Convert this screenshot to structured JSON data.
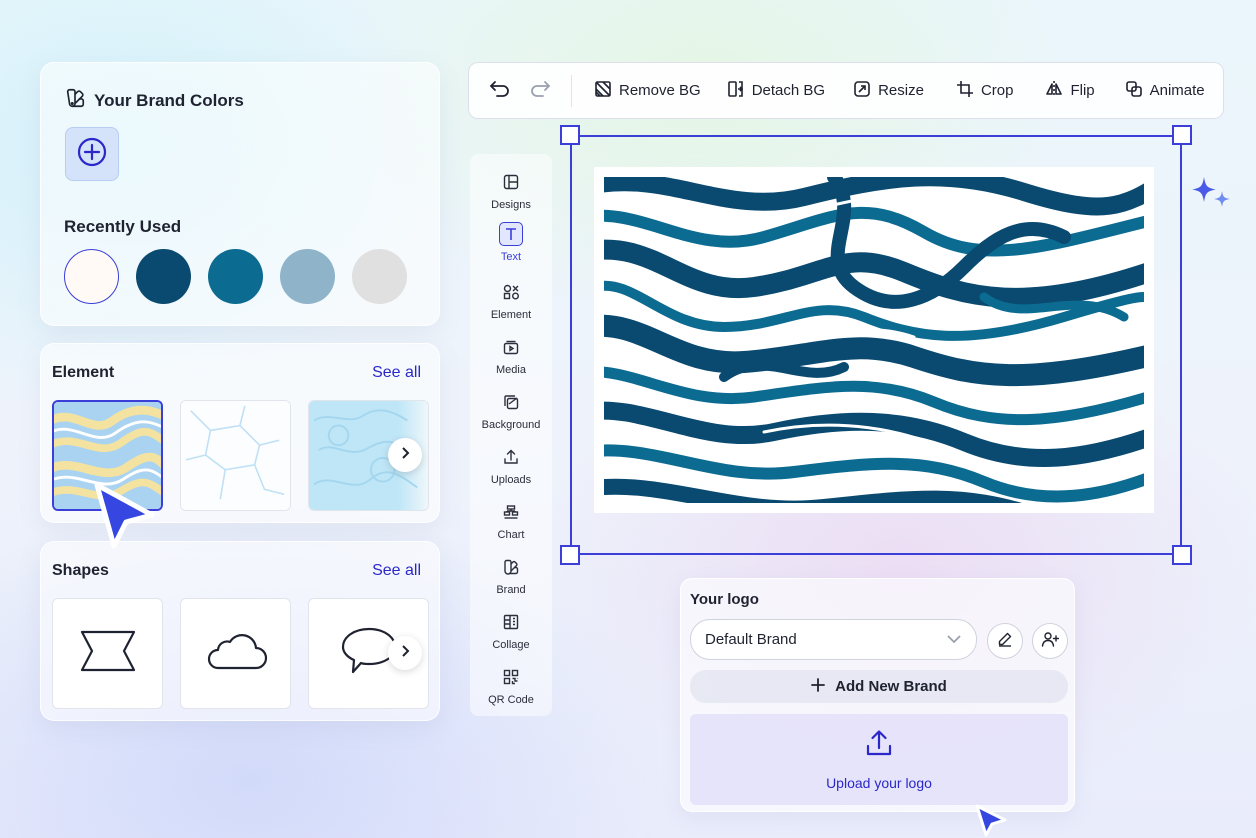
{
  "brand_colors": {
    "title": "Your Brand Colors",
    "recently_used_label": "Recently Used",
    "swatches": [
      "#fffaf6",
      "#0a4a70",
      "#0c6b91",
      "#8fb3c9",
      "#e0e0e0"
    ]
  },
  "element_section": {
    "title": "Element",
    "see_all": "See all"
  },
  "shapes_section": {
    "title": "Shapes",
    "see_all": "See all"
  },
  "toolbar": {
    "remove_bg": "Remove BG",
    "detach_bg": "Detach BG",
    "resize": "Resize",
    "crop": "Crop",
    "flip": "Flip",
    "animate": "Animate"
  },
  "side_rail": {
    "items": [
      "Designs",
      "Text",
      "Element",
      "Media",
      "Background",
      "Uploads",
      "Chart",
      "Brand",
      "Collage",
      "QR Code"
    ],
    "active": "Text"
  },
  "logo_panel": {
    "title": "Your logo",
    "brand_select_value": "Default Brand",
    "add_new_brand": "Add New Brand",
    "upload_label": "Upload your logo"
  },
  "colors": {
    "accent": "#3b3fd8",
    "link": "#2a28c8",
    "marble_dark": "#0a4a70",
    "marble_mid": "#0c6b91"
  }
}
